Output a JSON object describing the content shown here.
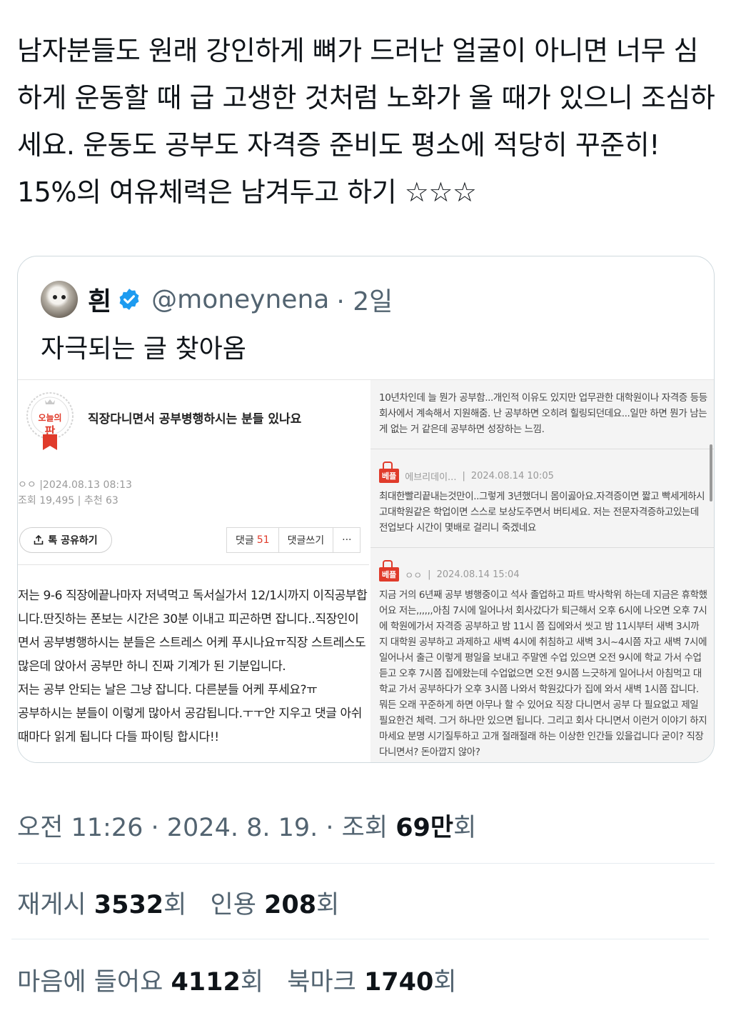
{
  "tweet": {
    "text": "남자분들도 원래 강인하게 뼈가 드러난 얼굴이 아니면 너무 심하게 운동할 때 급 고생한 것처럼 노화가 올 때가 있으니 조심하세요. 운동도 공부도 자격증 준비도 평소에 적당히 꾸준히! 15%의 여유체력은 남겨두고 하기 ☆☆☆"
  },
  "quote": {
    "name": "흰",
    "handle": "@moneynena",
    "time": "· 2일",
    "text": "자극되는 글 찾아옴",
    "avatar_icon": "hamster-avatar",
    "verified_color": "#1d9bf0"
  },
  "post": {
    "badge_line1": "오늘의",
    "badge_line2": "판",
    "title": "직장다니면서 공부병행하시는 분들 있나요",
    "author_date": "ㅇㅇ  |2024.08.13 08:13",
    "views_recs": "조회 19,495 | 추천 63",
    "share_label": "톡 공유하기",
    "comments_label": "댓글",
    "comments_count": "51",
    "write_comment": "댓글쓰기",
    "more": "···",
    "body": "저는 9-6 직장에끝나마자 저녁먹고 독서실가서 12/1시까지 이직공부합니다.딴짓하는 폰보는 시간은 30분 이내고 피곤하면 잡니다..직장인이면서 공부병행하시는 분들은 스트레스 어케 푸시나요ㅠ직장 스트레스도 많은데 앉아서 공부만 하니 진짜 기계가 된 기분입니다.\n저는 공부 안되는 날은 그냥 잡니다. 다른분들 어케 푸세요?ㅠ\n공부하시는 분들이 이렇게 많아서 공감됩니다.ㅜㅜ안 지우고 댓글 아쉬 때마다 읽게 됩니다 다들 파이팅 합시다!!"
  },
  "comments": [
    {
      "text": "10년차인데 늘 뭔가 공부함...개인적 이유도 있지만 업무관한 대학원이나 자격증 등등 회사에서 계속해서 지원해줌. 난 공부하면 오히려 힐링되던데요...일만 하면 뭔가 남는 게 없는 거 같은데 공부하면 성장하는 느낌."
    },
    {
      "tag": "베플",
      "author": "에브리데이...",
      "date": "2024.08.14 10:05",
      "text": "최대한빨리끝내는것만이..그렇게 3년했더니 몸이곯아요.자격증이면 짧고 빡세게하시고대학원같은 학업이면 스스로 보상도주면서 버티세요. 저는 전문자격증하고있는데 전업보다 시간이 몇배로 걸리니 죽겠네요"
    },
    {
      "tag": "베플",
      "author": "ㅇㅇ",
      "date": "2024.08.14 15:04",
      "text": "지금 거의 6년째 공부 병행중이고 석사 졸업하고 파트 박사학위 하는데 지금은 휴학했어요 저는,,,,,,아침 7시에 일어나서 회사갔다가 퇴근해서 오후 6시에 나오면 오후 7시에 학원에가서 자격증 공부하고 밤 11시 쯤 집에와서 씻고 밤 11시부터 새벽 3시까지 대학원 공부하고 과제하고 새벽 4시에 취침하고 새벽 3시~4시쯤 자고 새벽 7시에 일어나서 출근 이렇게 평일을 보내고 주말엔 수업 있으면 오전 9시에 학교 가서 수업 듣고 오후 7시쯤 집에왔는데 수업없으면 오전 9시쯤 느긋하게 일어나서 아침먹고 대학교 가서 공부하다가 오후 3시쯤 나와서 학원갔다가 집에 와서 새벽 1시쯤 잡니다. 뭐든 오래 꾸준하게 하면 아무나 할 수 있어요 직장 다니면서 공부 다 필요없고 제일 필요한건 체력. 그거 하나만 있으면 됩니다. 그리고 회사 다니면서 이런거 이야기 하지 마세요 분명 시기질투하고 고개 절래절래 하는 이상한 인간들 있을겁니다 굳이? 직장다니면서? 돈아깝지 않아?"
    }
  ],
  "stats": {
    "time": "오전 11:26 · 2024. 8. 19. · 조회 ",
    "views": "69만",
    "views_unit": "회",
    "reposts_label": "재게시 ",
    "reposts": "3532",
    "reposts_unit": "회",
    "quotes_label": "인용 ",
    "quotes": "208",
    "quotes_unit": "회",
    "likes_label": "마음에 들어요 ",
    "likes": "4112",
    "likes_unit": "회",
    "bookmarks_label": "북마크 ",
    "bookmarks": "1740",
    "bookmarks_unit": "회"
  }
}
